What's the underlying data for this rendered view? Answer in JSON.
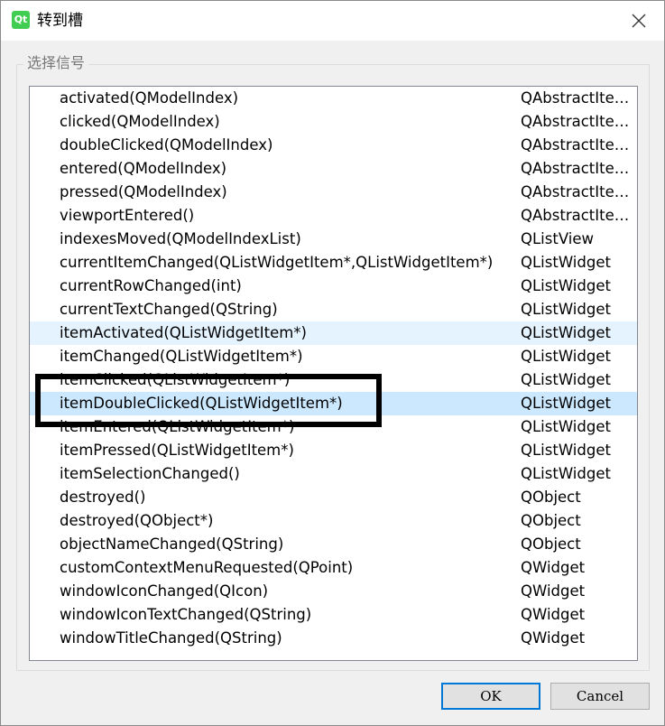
{
  "window": {
    "title": "转到槽",
    "app_icon_text": "Qt"
  },
  "group": {
    "title": "选择信号"
  },
  "signals": [
    {
      "signal": "activated(QModelIndex)",
      "class": "QAbstractIte…",
      "state": ""
    },
    {
      "signal": "clicked(QModelIndex)",
      "class": "QAbstractIte…",
      "state": ""
    },
    {
      "signal": "doubleClicked(QModelIndex)",
      "class": "QAbstractIte…",
      "state": ""
    },
    {
      "signal": "entered(QModelIndex)",
      "class": "QAbstractIte…",
      "state": ""
    },
    {
      "signal": "pressed(QModelIndex)",
      "class": "QAbstractIte…",
      "state": ""
    },
    {
      "signal": "viewportEntered()",
      "class": "QAbstractIte…",
      "state": ""
    },
    {
      "signal": "indexesMoved(QModelIndexList)",
      "class": "QListView",
      "state": ""
    },
    {
      "signal": "currentItemChanged(QListWidgetItem*,QListWidgetItem*)",
      "class": "QListWidget",
      "state": ""
    },
    {
      "signal": "currentRowChanged(int)",
      "class": "QListWidget",
      "state": ""
    },
    {
      "signal": "currentTextChanged(QString)",
      "class": "QListWidget",
      "state": ""
    },
    {
      "signal": "itemActivated(QListWidgetItem*)",
      "class": "QListWidget",
      "state": "hover"
    },
    {
      "signal": "itemChanged(QListWidgetItem*)",
      "class": "QListWidget",
      "state": ""
    },
    {
      "signal": "itemClicked(QListWidgetItem*)",
      "class": "QListWidget",
      "state": ""
    },
    {
      "signal": "itemDoubleClicked(QListWidgetItem*)",
      "class": "QListWidget",
      "state": "selected"
    },
    {
      "signal": "itemEntered(QListWidgetItem*)",
      "class": "QListWidget",
      "state": ""
    },
    {
      "signal": "itemPressed(QListWidgetItem*)",
      "class": "QListWidget",
      "state": ""
    },
    {
      "signal": "itemSelectionChanged()",
      "class": "QListWidget",
      "state": ""
    },
    {
      "signal": "destroyed()",
      "class": "QObject",
      "state": ""
    },
    {
      "signal": "destroyed(QObject*)",
      "class": "QObject",
      "state": ""
    },
    {
      "signal": "objectNameChanged(QString)",
      "class": "QObject",
      "state": ""
    },
    {
      "signal": "customContextMenuRequested(QPoint)",
      "class": "QWidget",
      "state": ""
    },
    {
      "signal": "windowIconChanged(QIcon)",
      "class": "QWidget",
      "state": ""
    },
    {
      "signal": "windowIconTextChanged(QString)",
      "class": "QWidget",
      "state": ""
    },
    {
      "signal": "windowTitleChanged(QString)",
      "class": "QWidget",
      "state": ""
    }
  ],
  "buttons": {
    "ok": "OK",
    "cancel": "Cancel"
  },
  "colors": {
    "hover_row": "#e5f3ff",
    "selected_row": "#cce8ff",
    "default_button_border": "#0078d7",
    "annotation_box": "#000000"
  }
}
